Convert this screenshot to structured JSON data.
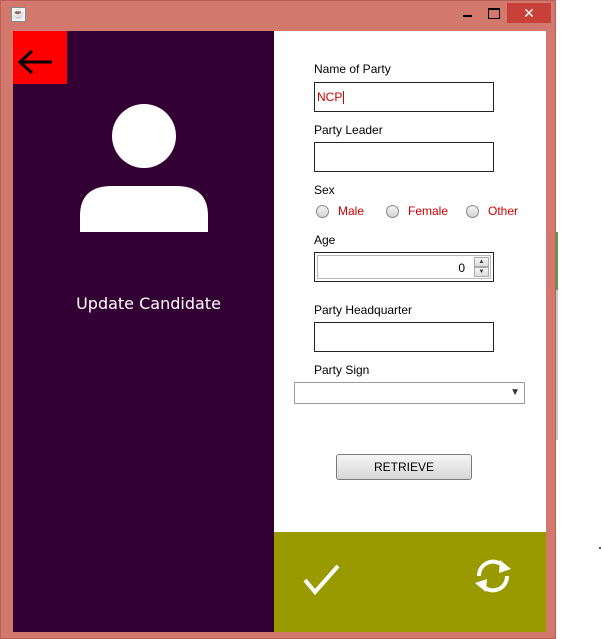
{
  "window": {
    "close_glyph": "✕"
  },
  "left_panel": {
    "title": "Update Candidate"
  },
  "form": {
    "name_of_party_label": "Name of Party",
    "name_of_party_value": "NCP",
    "party_leader_label": "Party Leader",
    "party_leader_value": "",
    "sex_label": "Sex",
    "sex_options": [
      "Male",
      "Female",
      "Other"
    ],
    "age_label": "Age",
    "age_value": "0",
    "party_headquarter_label": "Party Headquarter",
    "party_headquarter_value": "",
    "party_sign_label": "Party Sign",
    "party_sign_selected": "",
    "retrieve_label": "RETRIEVE"
  },
  "icons": {
    "back": "left-arrow-icon",
    "avatar": "user-avatar-icon",
    "confirm": "check-icon",
    "refresh": "refresh-icon"
  },
  "colors": {
    "left_panel_bg": "#330033",
    "back_button_bg": "#ff0000",
    "action_bar_bg": "#999900",
    "window_frame": "#d2786c",
    "close_button": "#c7403a",
    "field_text": "#cc0000"
  }
}
